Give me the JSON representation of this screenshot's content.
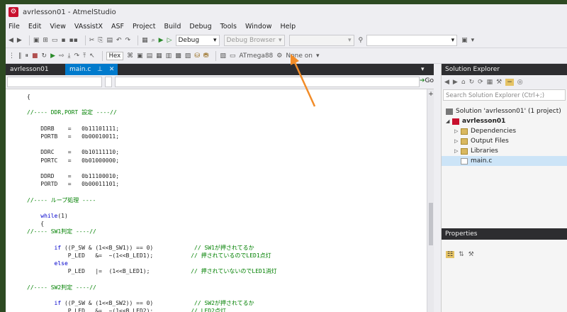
{
  "window": {
    "title": "avrlesson01 - AtmelStudio"
  },
  "menu": [
    "File",
    "Edit",
    "View",
    "VAssistX",
    "ASF",
    "Project",
    "Build",
    "Debug",
    "Tools",
    "Window",
    "Help"
  ],
  "toolbar1": {
    "config": "Debug",
    "debug_browser": "Debug Browser"
  },
  "toolbar2": {
    "hex_label": "Hex",
    "device": "ATmega88",
    "tool": "None on"
  },
  "tabs": [
    {
      "label": "avrlesson01",
      "active": false
    },
    {
      "label": "main.c",
      "active": true,
      "pin": "⊥",
      "close": "✕"
    }
  ],
  "navbar": {
    "go_label": "Go"
  },
  "code_lines": [
    [
      {
        "c": "txt",
        "t": "{"
      }
    ],
    [],
    [
      {
        "c": "cm",
        "t": "//---- DDR,PORT 設定 ----//"
      }
    ],
    [],
    [
      {
        "c": "txt",
        "t": "    DDRB    =   0b11101111;"
      }
    ],
    [
      {
        "c": "txt",
        "t": "    PORTB   =   0b00010011;"
      }
    ],
    [],
    [
      {
        "c": "txt",
        "t": "    DDRC    =   0b10111110;"
      }
    ],
    [
      {
        "c": "txt",
        "t": "    PORTC   =   0b01000000;"
      }
    ],
    [],
    [
      {
        "c": "txt",
        "t": "    DDRD    =   0b11100010;"
      }
    ],
    [
      {
        "c": "txt",
        "t": "    PORTD   =   0b00011101;"
      }
    ],
    [],
    [
      {
        "c": "cm",
        "t": "//---- ループ処理 ----"
      }
    ],
    [],
    [
      {
        "c": "kw",
        "t": "    while"
      },
      {
        "c": "txt",
        "t": "(1)"
      }
    ],
    [
      {
        "c": "txt",
        "t": "    {"
      }
    ],
    [
      {
        "c": "cm",
        "t": "//---- SW1判定 ----//"
      }
    ],
    [],
    [
      {
        "c": "kw",
        "t": "        if"
      },
      {
        "c": "txt",
        "t": " ((P_SW & (1<<B_SW1)) == 0)            "
      },
      {
        "c": "cm",
        "t": "// SW1が押されてるか"
      }
    ],
    [
      {
        "c": "txt",
        "t": "            P_LED   &=  ~(1<<B_LED1);           "
      },
      {
        "c": "cm",
        "t": "// 押されているのでLED1点灯"
      }
    ],
    [
      {
        "c": "kw",
        "t": "        else"
      }
    ],
    [
      {
        "c": "txt",
        "t": "            P_LED   |=  (1<<B_LED1);            "
      },
      {
        "c": "cm",
        "t": "// 押されていないのでLED1消灯"
      }
    ],
    [],
    [
      {
        "c": "cm",
        "t": "//---- SW2判定 ----//"
      }
    ],
    [],
    [
      {
        "c": "kw",
        "t": "        if"
      },
      {
        "c": "txt",
        "t": " ((P_SW & (1<<B_SW2)) == 0)            "
      },
      {
        "c": "cm",
        "t": "// SW2が押されてるか"
      }
    ],
    [
      {
        "c": "txt",
        "t": "            P_LED   &=  ~(1<<B_LED2);           "
      },
      {
        "c": "cm",
        "t": "// LED2点灯"
      }
    ]
  ],
  "solution_explorer": {
    "title": "Solution Explorer",
    "search_placeholder": "Search Solution Explorer (Ctrl+;)",
    "solution": "Solution 'avrlesson01' (1 project)",
    "project": "avrlesson01",
    "items": [
      {
        "label": "Dependencies",
        "type": "folder",
        "expandable": true
      },
      {
        "label": "Output Files",
        "type": "folder",
        "expandable": true
      },
      {
        "label": "Libraries",
        "type": "folder",
        "expandable": true
      },
      {
        "label": "main.c",
        "type": "file",
        "expandable": false
      }
    ]
  },
  "properties": {
    "title": "Properties"
  },
  "annotation": {
    "color": "#f28c28"
  }
}
